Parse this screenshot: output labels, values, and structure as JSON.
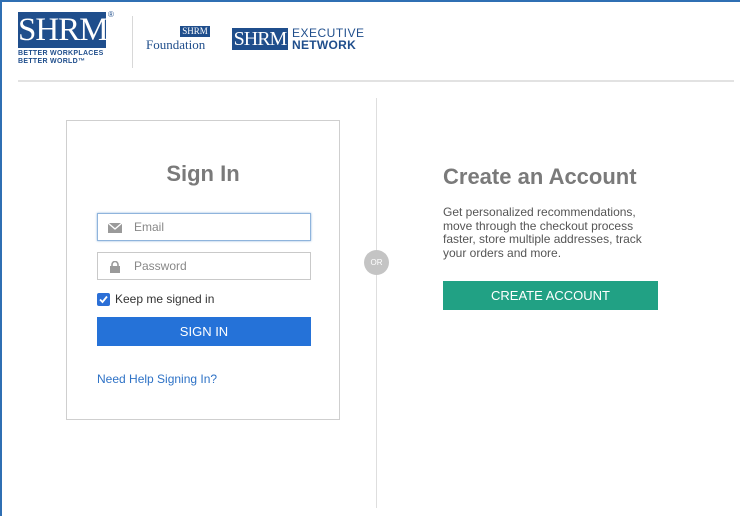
{
  "header": {
    "shrm_logo_text": "SHRM",
    "shrm_registered": "®",
    "shrm_tagline_1": "BETTER WORKPLACES",
    "shrm_tagline_2": "BETTER WORLD™",
    "foundation_logo_mark": "SHRM",
    "foundation_logo_text": "Foundation",
    "exec_logo_mark": "SHRM",
    "exec_logo_line1": "EXECUTIVE",
    "exec_logo_line2": "NETWORK"
  },
  "signin": {
    "title": "Sign In",
    "email_placeholder": "Email",
    "password_placeholder": "Password",
    "keep_signed_in": "Keep me signed in",
    "keep_signed_in_checked": true,
    "button": "SIGN IN",
    "help_link": "Need Help Signing In?"
  },
  "divider": {
    "label": "OR"
  },
  "create": {
    "title": "Create an Account",
    "description": "Get personalized recommendations, move through the checkout process faster, store multiple addresses, track your orders and more.",
    "button": "CREATE ACCOUNT"
  },
  "colors": {
    "brand_blue": "#1f4e8c",
    "signin_button": "#2572d8",
    "create_button": "#21a184",
    "link": "#2e72c6"
  },
  "icons": {
    "email": "envelope-icon",
    "password": "lock-icon",
    "checkbox": "checkmark-icon"
  }
}
